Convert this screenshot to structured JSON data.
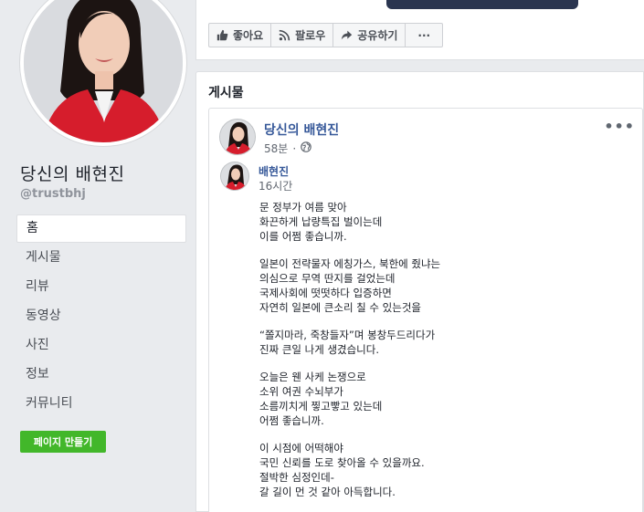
{
  "sidebar": {
    "page_name": "당신의 배현진",
    "handle": "@trustbhj",
    "nav": [
      {
        "label": "홈",
        "active": true
      },
      {
        "label": "게시물",
        "active": false
      },
      {
        "label": "리뷰",
        "active": false
      },
      {
        "label": "동영상",
        "active": false
      },
      {
        "label": "사진",
        "active": false
      },
      {
        "label": "정보",
        "active": false
      },
      {
        "label": "커뮤니티",
        "active": false
      }
    ],
    "create_page_label": "페이지 만들기"
  },
  "actions": {
    "like_label": "좋아요",
    "follow_label": "팔로우",
    "share_label": "공유하기",
    "more_label": "···"
  },
  "posts": {
    "section_title": "게시물",
    "post": {
      "author": "당신의 배현진",
      "time": "58분",
      "more_label": "•••",
      "shared": {
        "author": "배현진",
        "time": "16시간"
      },
      "paragraphs": [
        [
          "문 정부가 여름 맞아",
          "화끈하게 납량특집 벌이는데",
          "이를 어쩜 좋습니까."
        ],
        [
          "일본이 전략물자 에칭가스, 북한에 줬냐는",
          "의심으로 무역 딴지를 걸었는데",
          "국제사회에 떳떳하다 입증하면",
          "자연히 일본에 큰소리 칠 수 있는것을"
        ],
        [
          "“쫄지마라, 죽창들자”며 봉창두드리다가",
          "진짜 큰일 나게 생겼습니다."
        ],
        [
          "오늘은 웬 사케 논쟁으로",
          "소위 여권 수뇌부가",
          "소름끼치게 찧고빻고 있는데",
          "어쩜 좋습니까."
        ],
        [
          "이 시점에 어떡해야",
          "국민 신뢰를 도로 찾아올 수 있을까요.",
          "절박한 심정인데-",
          "갈 길이 먼 것 같아 아득합니다."
        ]
      ]
    }
  },
  "colors": {
    "accent_link": "#365899",
    "create_button": "#42b72a",
    "page_bg": "#e9ebee"
  }
}
